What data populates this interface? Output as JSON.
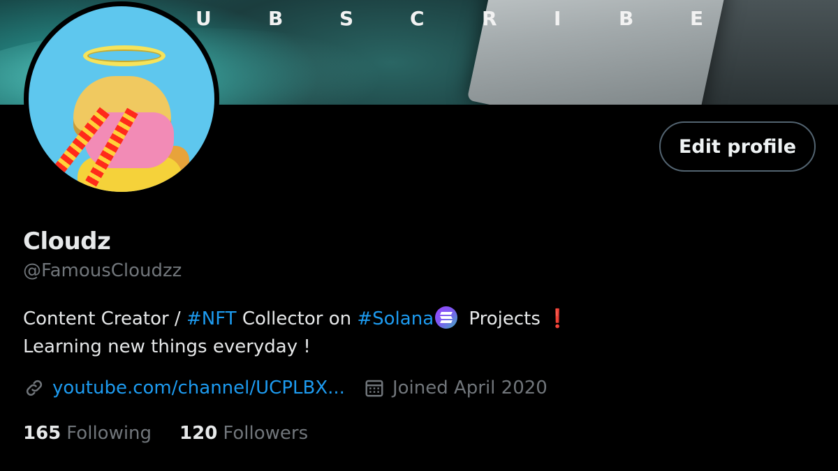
{
  "banner": {
    "letters": [
      "U",
      "B",
      "S",
      "C",
      "R",
      "I",
      "B",
      "E"
    ],
    "colors": {
      "teal": "#3fb3ad",
      "slab": "#a3aaac"
    }
  },
  "profile": {
    "display_name": "Cloudz",
    "handle": "@FamousCloudzz",
    "edit_button_label": "Edit profile",
    "bio": {
      "line1_part1": "Content Creator / ",
      "hashtag_nft": "#NFT",
      "line1_part2": " Collector on ",
      "hashtag_solana": "#Solana",
      "line1_part3": " Projects ",
      "line1_exclaim": "❗",
      "line2": "Learning new things everyday !"
    },
    "link": {
      "icon": "link-icon",
      "text": "youtube.com/channel/UCPLBX..."
    },
    "joined": {
      "icon": "calendar-icon",
      "text": "Joined April 2020"
    },
    "stats": {
      "following_count": "165",
      "following_label": "Following",
      "followers_count": "120",
      "followers_label": "Followers"
    }
  },
  "colors": {
    "background": "#000000",
    "text": "#e7e9ea",
    "muted": "#71767b",
    "accent": "#1d9bf0",
    "button_border": "#536471"
  }
}
